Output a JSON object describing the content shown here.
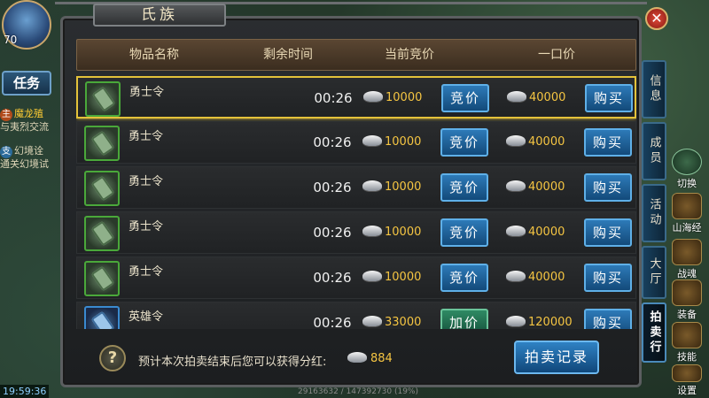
{
  "hud": {
    "level": "70",
    "task_tab": "任务",
    "quests": [
      {
        "tag": "主",
        "title": "魔龙殖",
        "desc": "与夷烈交流"
      },
      {
        "tag": "支",
        "title": "幻境诠",
        "desc": "通关幻境试"
      }
    ],
    "clock": "19:59:36",
    "right_buttons": [
      "切换",
      "山海经",
      "战魂",
      "装备",
      "技能",
      "设置"
    ]
  },
  "panel": {
    "title": "氏族",
    "columns": {
      "name": "物品名称",
      "time": "剩余时间",
      "bid": "当前竞价",
      "buyout": "一口价"
    },
    "rows": [
      {
        "name": "勇士令",
        "time": "00:26",
        "bid": "10000",
        "bid_action": "竞价",
        "buyout": "40000",
        "buy_action": "购买",
        "selected": true,
        "rarity": "green"
      },
      {
        "name": "勇士令",
        "time": "00:26",
        "bid": "10000",
        "bid_action": "竞价",
        "buyout": "40000",
        "buy_action": "购买",
        "selected": false,
        "rarity": "green"
      },
      {
        "name": "勇士令",
        "time": "00:26",
        "bid": "10000",
        "bid_action": "竞价",
        "buyout": "40000",
        "buy_action": "购买",
        "selected": false,
        "rarity": "green"
      },
      {
        "name": "勇士令",
        "time": "00:26",
        "bid": "10000",
        "bid_action": "竞价",
        "buyout": "40000",
        "buy_action": "购买",
        "selected": false,
        "rarity": "green"
      },
      {
        "name": "勇士令",
        "time": "00:26",
        "bid": "10000",
        "bid_action": "竞价",
        "buyout": "40000",
        "buy_action": "购买",
        "selected": false,
        "rarity": "green"
      },
      {
        "name": "英雄令",
        "time": "00:26",
        "bid": "33000",
        "bid_action": "加价",
        "buyout": "120000",
        "buy_action": "购买",
        "selected": false,
        "rarity": "blue"
      }
    ],
    "footer_text": "预计本次拍卖结束后您可以获得分红:",
    "dividend": "884",
    "record_button": "拍卖记录",
    "side_tabs": [
      "信息",
      "成员",
      "活动",
      "大厅",
      "拍卖行"
    ],
    "active_side_tab": "拍卖行"
  },
  "status_line": "29163632 / 147392730 (19%)",
  "colors": {
    "gold": "#f5c542",
    "selected_border": "#e4c23a",
    "button_blue": "#2d7ab8",
    "button_green": "#2f8a64"
  }
}
